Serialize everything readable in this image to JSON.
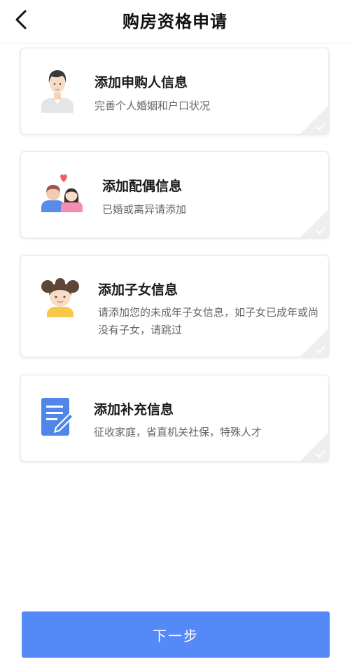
{
  "header": {
    "title": "购房资格申请"
  },
  "cards": [
    {
      "title": "添加申购人信息",
      "desc": "完善个人婚姻和户口状况",
      "icon": "buyer-man-icon"
    },
    {
      "title": "添加配偶信息",
      "desc": "已婚或离异请添加",
      "icon": "couple-heart-icon"
    },
    {
      "title": "添加子女信息",
      "desc": "请添加您的未成年子女信息，如子女已成年或尚没有子女，请跳过",
      "icon": "girl-child-icon"
    },
    {
      "title": "添加补充信息",
      "desc": "征收家庭，省直机关社保，特殊人才",
      "icon": "document-pen-icon"
    }
  ],
  "footer": {
    "next_label": "下一步"
  },
  "colors": {
    "primary": "#5589f7",
    "icon_blue": "#4f86ea",
    "heart": "#f05a6b"
  }
}
